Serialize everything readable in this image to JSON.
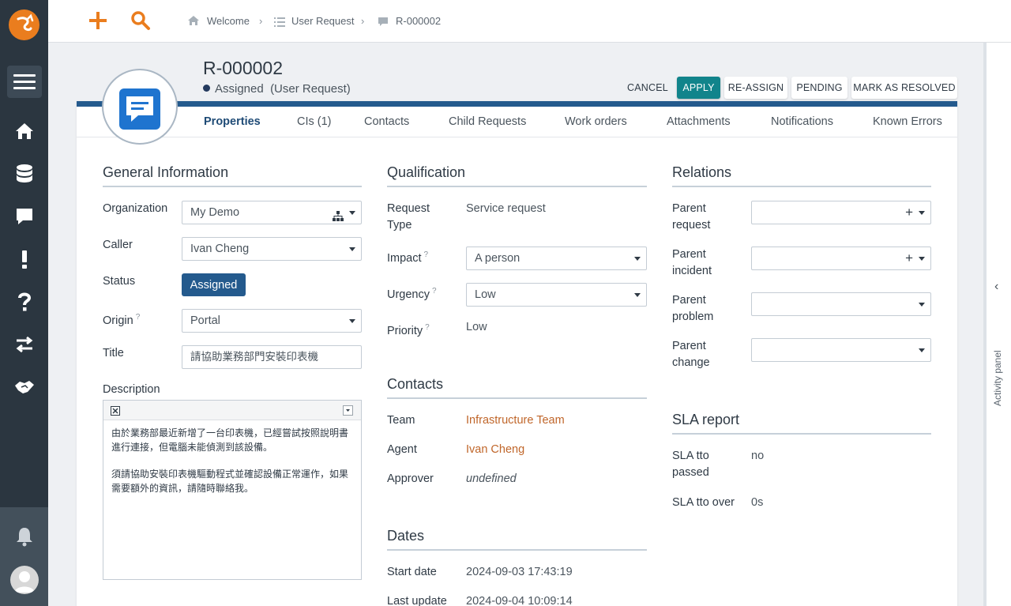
{
  "breadcrumb": {
    "home": "Welcome",
    "list": "User Request",
    "current": "R-000002"
  },
  "header": {
    "title": "R-000002",
    "status": "Assigned",
    "status_class": "(User Request)",
    "actions": {
      "cancel": "CANCEL",
      "apply": "APPLY",
      "reassign": "RE-ASSIGN",
      "pending": "PENDING",
      "resolve": "MARK AS RESOLVED"
    }
  },
  "tabs": [
    "Properties",
    "CIs (1)",
    "Contacts",
    "Child Requests",
    "Work orders",
    "Attachments",
    "Notifications",
    "Known Errors"
  ],
  "general": {
    "title": "General Information",
    "organization_label": "Organization",
    "organization_value": "My Demo",
    "caller_label": "Caller",
    "caller_value": "Ivan Cheng",
    "status_label": "Status",
    "status_value": "Assigned",
    "origin_label": "Origin",
    "origin_value": "Portal",
    "title_label": "Title",
    "title_value": "請協助業務部門安裝印表機",
    "description_label": "Description",
    "description_p1": "由於業務部最近新增了一台印表機，已經嘗試按照說明書進行連接，但電腦未能偵測到該設備。",
    "description_p2": "須請協助安裝印表機驅動程式並確認設備正常運作，如果需要額外的資訊，請隨時聯絡我。"
  },
  "qualification": {
    "title": "Qualification",
    "request_type_label_1": "Request",
    "request_type_label_2": "Type",
    "request_type_value": "Service request",
    "impact_label": "Impact",
    "impact_value": "A person",
    "urgency_label": "Urgency",
    "urgency_value": "Low",
    "priority_label": "Priority",
    "priority_value": "Low"
  },
  "contacts": {
    "title": "Contacts",
    "team_label": "Team",
    "team_value": "Infrastructure Team",
    "agent_label": "Agent",
    "agent_value": "Ivan Cheng",
    "approver_label": "Approver",
    "approver_value": "undefined"
  },
  "dates": {
    "title": "Dates",
    "start_label": "Start date",
    "start_value": "2024-09-03 17:43:19",
    "update_label": "Last update",
    "update_value": "2024-09-04 10:09:14"
  },
  "relations": {
    "title": "Relations",
    "parent_request_1": "Parent",
    "parent_request_2": "request",
    "parent_incident_1": "Parent",
    "parent_incident_2": "incident",
    "parent_problem_1": "Parent",
    "parent_problem_2": "problem",
    "parent_change_1": "Parent",
    "parent_change_2": "change"
  },
  "sla": {
    "title": "SLA report",
    "tto_passed_label_1": "SLA tto",
    "tto_passed_label_2": "passed",
    "tto_passed_value": "no",
    "tto_over_label": "SLA tto over",
    "tto_over_value": "0s"
  },
  "activity_panel": {
    "label": "Activity panel"
  },
  "colors": {
    "brand": "#ea7d1e",
    "primary": "#11848b",
    "accent": "#245a8d",
    "link": "#c0662a",
    "sidebar": "#2b3640"
  }
}
